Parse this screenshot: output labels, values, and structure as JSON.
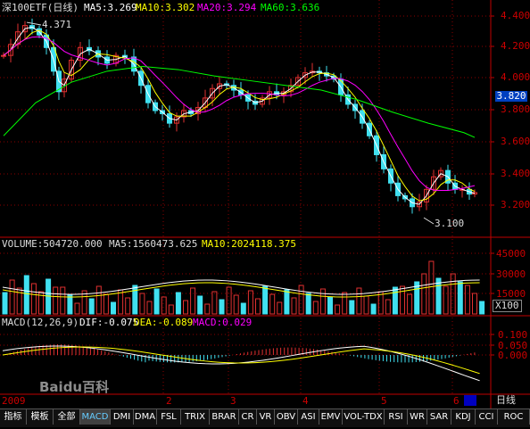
{
  "colors": {
    "up": "#e03030",
    "down": "#40e0f0",
    "ma5": "#ffffff",
    "ma10": "#ffff00",
    "ma20": "#ff00ff",
    "ma60": "#00ff00",
    "dif": "#ffffff",
    "dea": "#ffff00",
    "grid": "#8b0000",
    "axis": "#c00000"
  },
  "main": {
    "title": "深100ETF(日线)",
    "ma5": "MA5:3.269",
    "ma10": "MA10:3.302",
    "ma20": "MA20:3.294",
    "ma60": "MA60:3.636",
    "high_marker": "4.371",
    "low_marker": "3.100",
    "current_price": "3.820",
    "y_ticks": [
      "4.400",
      "4.200",
      "4.000",
      "3.800",
      "3.600",
      "3.400",
      "3.200"
    ],
    "y_range": [
      3.05,
      4.45
    ]
  },
  "volume": {
    "label": "VOLUME:504720.000",
    "ma5": "MA5:1560473.625",
    "ma10": "MA10:2024118.375",
    "y_ticks": [
      "45000",
      "30000",
      "15000"
    ],
    "unit": "X100"
  },
  "macd": {
    "label": "MACD(12,26,9)",
    "dif": "DIF:-0.075",
    "dea": "DEA:-0.089",
    "macd": "MACD:0.029",
    "y_ticks": [
      "0.100",
      "0.050",
      "0.000"
    ]
  },
  "xaxis": {
    "year": "2009",
    "months": [
      "2",
      "3",
      "4",
      "5",
      "6"
    ]
  },
  "period": "日线",
  "watermark": "Baidu百科",
  "tabs": [
    "指标",
    "模板",
    "全部",
    "MACD",
    "DMI",
    "DMA",
    "FSL",
    "TRIX",
    "BRAR",
    "CR",
    "VR",
    "OBV",
    "ASI",
    "EMV",
    "VOL-TDX",
    "RSI",
    "WR",
    "SAR",
    "KDJ",
    "CCI",
    "ROC"
  ],
  "active_tab": "MACD",
  "chart_data": {
    "type": "line",
    "title": "深100ETF(日线)",
    "x": [
      "2009-01",
      "2009-02",
      "2009-03",
      "2009-04",
      "2009-05",
      "2009-06"
    ],
    "series": [
      {
        "name": "MA60",
        "values": [
          3.88,
          4.06,
          4.03,
          3.93,
          3.75,
          3.65
        ]
      },
      {
        "name": "MA5",
        "values": [
          4.3,
          4.1,
          3.8,
          4.02,
          3.35,
          3.27
        ]
      }
    ],
    "ylim": [
      3.05,
      4.45
    ]
  }
}
